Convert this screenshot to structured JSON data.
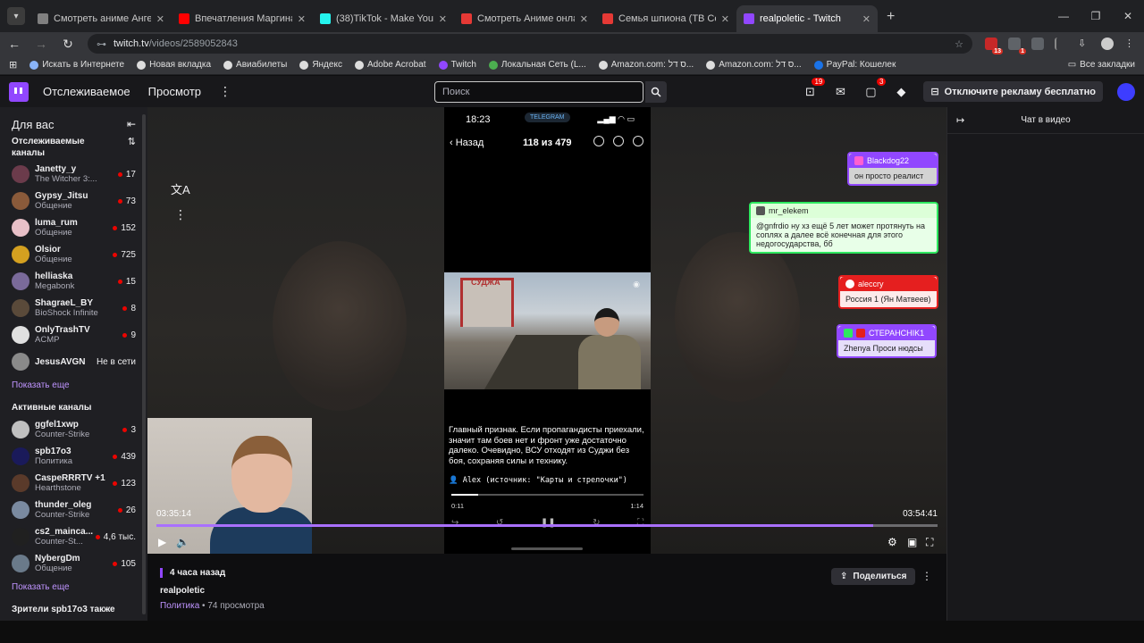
{
  "browser": {
    "tabs": [
      {
        "title": "Смотреть аниме Ангельские р",
        "color": "#808080",
        "active": false
      },
      {
        "title": "Впечатления Маргинала от де",
        "color": "#ff0000",
        "active": false
      },
      {
        "title": "(38)TikTok - Make Your Day",
        "color": "#25f4ee",
        "active": false
      },
      {
        "title": "Смотреть Аниме онлайн бесп",
        "color": "#e53935",
        "active": false
      },
      {
        "title": "Семья шпиона (ТВ Сериал, 3 с",
        "color": "#e53935",
        "active": false
      },
      {
        "title": "realpoletic - Twitch",
        "color": "#9147ff",
        "active": true
      }
    ],
    "url_host": "twitch.tv",
    "url_path": "/videos/2589052843",
    "bookmarks": [
      "Искать в Интернете",
      "Новая вкладка",
      "Авиабилеты",
      "Яндекс",
      "Adobe Acrobat",
      "Twitch",
      "Локальная Сеть (L...",
      "Amazon.com: ס דל...",
      "Amazon.com: ס דל...",
      "PayPal: Кошелек"
    ],
    "bookmarks_all": "Все закладки",
    "ext_badges": [
      "13",
      "1"
    ]
  },
  "topnav": {
    "following": "Отслеживаемое",
    "browse": "Просмотр",
    "search_placeholder": "Поиск",
    "inbox_badge": "19",
    "notif_badge": "3",
    "adfree": "Отключите рекламу бесплатно"
  },
  "sidebar": {
    "for_you": "Для вас",
    "followed_title": "Отслеживаемые каналы",
    "followed": [
      {
        "name": "Janetty_y",
        "game": "The Witcher 3:...",
        "viewers": "17",
        "color": "#6b3b4b"
      },
      {
        "name": "Gypsy_Jitsu",
        "game": "Общение",
        "viewers": "73",
        "color": "#8a5a3a"
      },
      {
        "name": "luma_rum",
        "game": "Общение",
        "viewers": "152",
        "color": "#e8c0c8"
      },
      {
        "name": "Olsior",
        "game": "Общение",
        "viewers": "725",
        "color": "#d4a020"
      },
      {
        "name": "helliaska",
        "game": "Megabonk",
        "viewers": "15",
        "color": "#7a6a9a"
      },
      {
        "name": "ShagraeL_BY",
        "game": "BioShock Infinite",
        "viewers": "8",
        "color": "#5a4a3a"
      },
      {
        "name": "OnlyTrashTV",
        "game": "ACMP",
        "viewers": "9",
        "color": "#e0e0e0"
      },
      {
        "name": "JesusAVGN",
        "game": "",
        "viewers": "Не в сети",
        "color": "#8a8a8a"
      }
    ],
    "show_more": "Показать еще",
    "active_title": "Активные каналы",
    "active": [
      {
        "name": "ggfel1xwp",
        "game": "Counter-Strike",
        "viewers": "3",
        "color": "#c0c0c0"
      },
      {
        "name": "spb17o3",
        "game": "Политика",
        "viewers": "439",
        "color": "#1a1a5a"
      },
      {
        "name": "CaspeRRRTV +1",
        "game": "Hearthstone",
        "viewers": "123",
        "color": "#5a3a2a"
      },
      {
        "name": "thunder_oleg",
        "game": "Counter-Strike",
        "viewers": "26",
        "color": "#7a8aa0"
      },
      {
        "name": "cs2_mainca...",
        "game": "Counter-St...",
        "viewers": "4,6 тыс.",
        "color": "#202020"
      },
      {
        "name": "NybergDm",
        "game": "Общение",
        "viewers": "105",
        "color": "#6a7a8a"
      }
    ],
    "show_more2": "Показать еще",
    "viewers_also": "Зрители spb17o3 также"
  },
  "phone": {
    "time": "18:23",
    "tg_badge": "TELEGRAM",
    "back": "Назад",
    "counter": "118 из 479",
    "sign_text": "СУДЖА",
    "caption": "Главный признак. Если пропагандисты приехали, значит там боев нет и фронт уже достаточно далеко. Очевидно, ВСУ отходят из Суджи без боя, сохраняя силы и технику.",
    "source": "👤 Alex (источник: \"Карты и стрелочки\")",
    "t_start": "0:11",
    "t_end": "1:14",
    "progress": 0.14
  },
  "chat_overlay": [
    {
      "user": "Blackdog22",
      "msg": "он просто реалист"
    },
    {
      "user": "mr_elekem",
      "msg": "@gnfrdio ну хз ещё 5 лет может протянуть на соплях а далее всё конечная для этого недогосударства, бб"
    },
    {
      "user": "aleccry",
      "msg": "Россия 1 (Ян Матвеев)"
    },
    {
      "user": "СТЕРАНСНIK1",
      "msg": "Zhenya Проси нюдсы"
    }
  ],
  "player": {
    "time_current": "03:35:14",
    "time_total": "03:54:41",
    "progress": 0.918
  },
  "video_info": {
    "ago": "4 часа назад",
    "channel": "realpoletic",
    "category": "Политика",
    "views": " • 74 просмотра",
    "share": "Поделиться"
  },
  "chat_panel": {
    "title": "Чат в видео"
  }
}
